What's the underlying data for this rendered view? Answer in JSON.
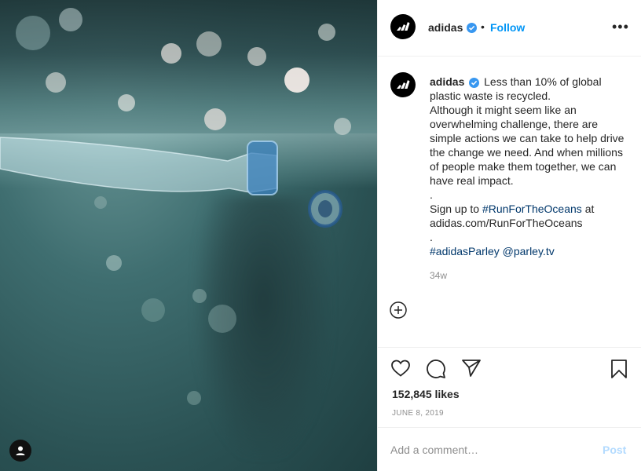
{
  "post": {
    "image_alt": "",
    "author": "adidas",
    "follow_label": "Follow",
    "more_label": "•••",
    "dot_separator": "•",
    "caption": {
      "author": "adidas",
      "line1": "Less than 10% of global plastic waste is recycled.",
      "line2": "Although it might seem like an overwhelming challenge, there are simple actions we can take to help drive the change we need. And when millions of people make them together, we can have real impact.",
      "dot1": ".",
      "signup_prefix": "Sign up to",
      "hashtag_run": "#RunForTheOceans",
      "signup_suffix": "at adidas.com/RunForTheOceans",
      "dot2": ".",
      "hashtag_parley": "#adidasParley",
      "mention_parley": "@parley.tv"
    },
    "time_ago": "34w",
    "likes": "152,845 likes",
    "date": "JUNE 8, 2019",
    "comment_placeholder": "Add a comment…",
    "post_label": "Post"
  },
  "icons": {
    "verified": "verified-badge-icon",
    "like": "heart-icon",
    "comment": "comment-icon",
    "share": "paper-plane-icon",
    "save": "bookmark-icon",
    "add": "plus-circle-icon",
    "user": "user-icon"
  },
  "colors": {
    "accent": "#0095f6",
    "link": "#00376b",
    "muted": "#8e8e8e",
    "verified": "#3897f0",
    "post_disabled": "#b3dbff"
  }
}
